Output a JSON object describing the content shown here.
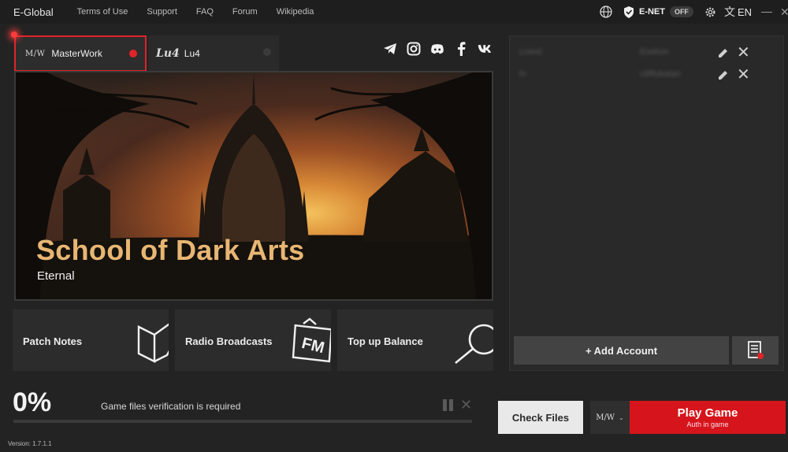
{
  "app": {
    "title": "E-Global",
    "version": "Version: 1.7.1.1"
  },
  "nav": {
    "items": [
      "Terms of Use",
      "Support",
      "FAQ",
      "Forum",
      "Wikipedia"
    ]
  },
  "top_right": {
    "enet_label": "E-NET",
    "enet_state": "OFF",
    "language": "EN",
    "icons": [
      "globe-icon",
      "shield-icon",
      "gear-icon",
      "translate-icon",
      "minimize-icon",
      "close-icon"
    ]
  },
  "tabs": [
    {
      "logo": "M/W",
      "label": "MasterWork",
      "status_color": "#e0242a"
    },
    {
      "logo": "Lu4",
      "label": "Lu4",
      "status_color": "#3b3b3b"
    }
  ],
  "socials": [
    "telegram-icon",
    "instagram-icon",
    "discord-icon",
    "facebook-icon",
    "vk-icon"
  ],
  "banner": {
    "title": "School of Dark Arts",
    "subtitle": "Eternal"
  },
  "cards": [
    {
      "label": "Patch Notes",
      "icon": "book-icon"
    },
    {
      "label": "Radio Broadcasts",
      "icon": "fm-radio-icon"
    },
    {
      "label": "Top up Balance",
      "icon": "magnifier-coin-icon"
    }
  ],
  "progress": {
    "percent_label": "0%",
    "value": 0,
    "message": "Game files verification is required"
  },
  "accounts": {
    "rows": [
      {
        "name": "Lnerd",
        "server": "Exekon"
      },
      {
        "name": "ln",
        "server": "Uliftukatan"
      }
    ],
    "add_label": "+  Add Account"
  },
  "actions": {
    "check_files": "Check Files",
    "game_select": "M/W",
    "play_label": "Play Game",
    "play_sub": "Auth in game"
  },
  "colors": {
    "accent": "#e0242a",
    "play": "#d5151b",
    "banner_title": "#e8b673",
    "background": "#232323"
  }
}
